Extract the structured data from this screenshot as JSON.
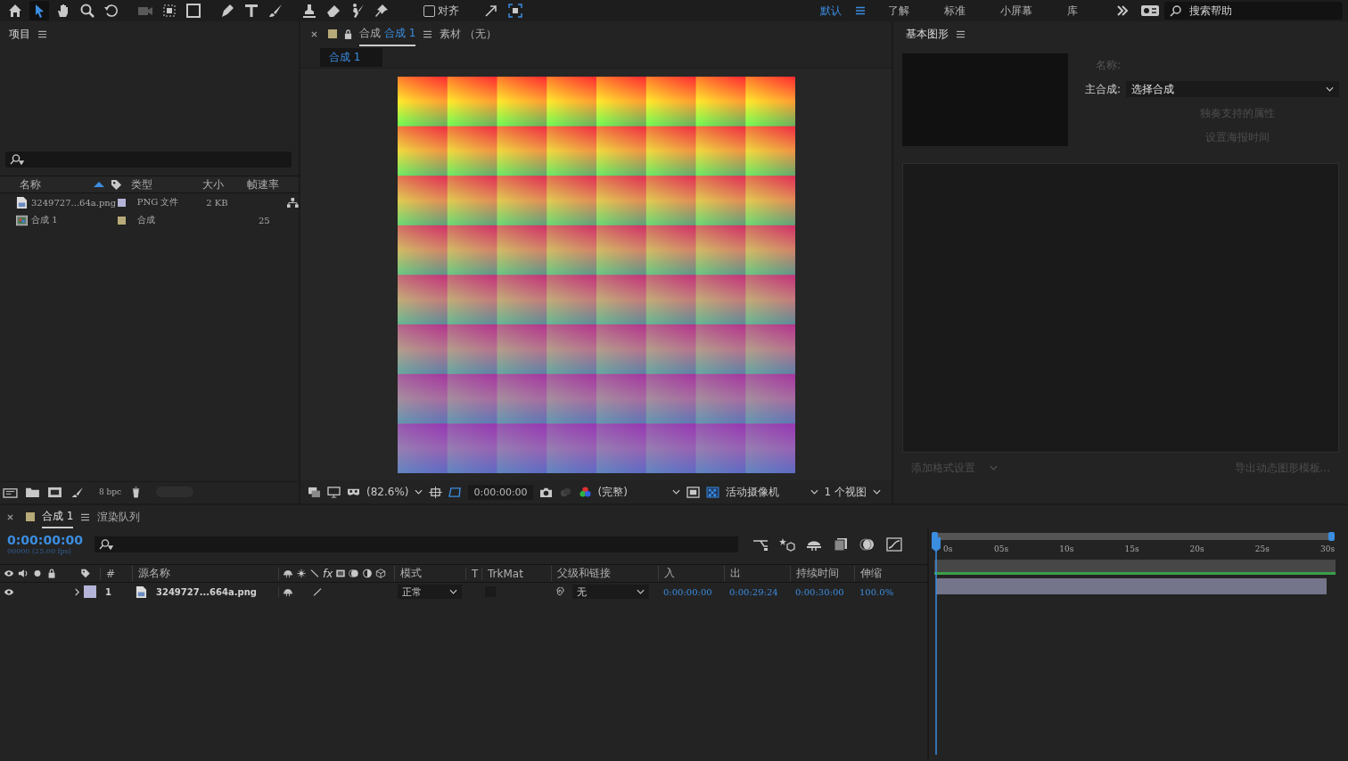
{
  "toolbar": {
    "tools": [
      {
        "selected": true
      },
      {
        "selected": false
      },
      {
        "selected": false
      },
      {
        "selected": false
      },
      {
        "selected": false
      },
      {
        "selected": false
      },
      {
        "selected": false
      },
      {
        "selected": false
      },
      {
        "selected": false
      },
      {
        "selected": false
      },
      {
        "selected": false
      },
      {
        "selected": false
      },
      {
        "selected": false
      },
      {
        "selected": false
      }
    ],
    "snap": {
      "label": "对齐",
      "checked": false
    },
    "workspaces": [
      {
        "label": "默认",
        "selected": true
      },
      {
        "label": "了解",
        "selected": false
      },
      {
        "label": "标准",
        "selected": false
      },
      {
        "label": "小屏幕",
        "selected": false
      },
      {
        "label": "库",
        "selected": false
      }
    ],
    "search": {
      "placeholder": "搜索帮助"
    }
  },
  "project": {
    "title": "项目",
    "columns": [
      "名称",
      "类型",
      "大小",
      "帧速率"
    ],
    "rows": [
      {
        "kind": "footage",
        "name": "3249727...64a.png",
        "type": "PNG 文件",
        "size": "2 KB",
        "fps": "",
        "color": "#b4b4d8"
      },
      {
        "kind": "composition",
        "name": "合成 1",
        "type": "合成",
        "size": "",
        "fps": "25",
        "color": "#b8aa78"
      }
    ],
    "bit_depth": "8 bpc"
  },
  "viewer": {
    "tabs": [
      {
        "prefix": "合成",
        "label": "合成 1",
        "selected": true,
        "locked": true
      },
      {
        "prefix": "素材",
        "label": "（无）",
        "selected": false,
        "locked": false
      }
    ],
    "breadcrumb": "合成 1",
    "zoom": "(82.6%)",
    "time": "0:00:00:00",
    "resolution": "(完整)",
    "camera": "活动摄像机",
    "views": "1 个视图"
  },
  "graphics": {
    "title": "基本图形",
    "name_label": "名称:",
    "master_label": "主合成:",
    "master_value": "选择合成",
    "buttons": [
      "独奏支持的属性",
      "设置海报时间"
    ],
    "format_button": "添加格式设置",
    "export_button": "导出动态图形模板..."
  },
  "timeline": {
    "tabs": [
      {
        "label": "合成 1",
        "selected": true,
        "color": "#b8aa78"
      },
      {
        "label": "渲染队列",
        "selected": false
      }
    ],
    "timecode": "0:00:00:00",
    "frames": "00000 (25.00 fps)",
    "columns": {
      "index": "#",
      "source": "源名称",
      "fx": "fx",
      "mode": "模式",
      "t": "T",
      "trkmat": "TrkMat",
      "parent": "父级和链接",
      "in": "入",
      "out": "出",
      "duration": "持续时间",
      "stretch": "伸缩"
    },
    "layers": [
      {
        "visible": true,
        "color": "#b4b4d8",
        "index": "1",
        "name": "3249727...664a.png",
        "mode": "正常",
        "parent": "无",
        "in": "0:00:00:00",
        "out": "0:00:29:24",
        "duration": "0:00:30:00",
        "stretch": "100.0%"
      }
    ],
    "ruler": [
      "0s",
      "05s",
      "10s",
      "15s",
      "20s",
      "25s",
      "30s"
    ]
  }
}
